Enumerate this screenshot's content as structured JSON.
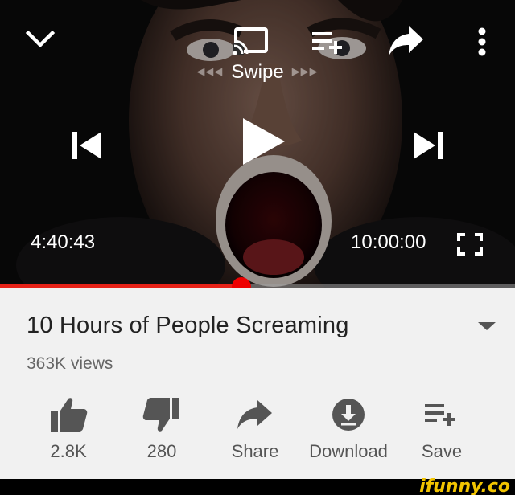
{
  "player": {
    "swipe_hint": "Swipe",
    "current_time": "4:40:43",
    "duration": "10:00:00",
    "progress_fraction": 0.468,
    "accent_color": "#e62117"
  },
  "video": {
    "title": "10 Hours of People Screaming",
    "views": "363K views"
  },
  "actions": [
    {
      "label": "2.8K",
      "icon": "thumbs-up-icon"
    },
    {
      "label": "280",
      "icon": "thumbs-down-icon"
    },
    {
      "label": "Share",
      "icon": "share-icon"
    },
    {
      "label": "Download",
      "icon": "download-icon"
    },
    {
      "label": "Save",
      "icon": "playlist-add-icon"
    }
  ],
  "watermark": "ifunny.co"
}
